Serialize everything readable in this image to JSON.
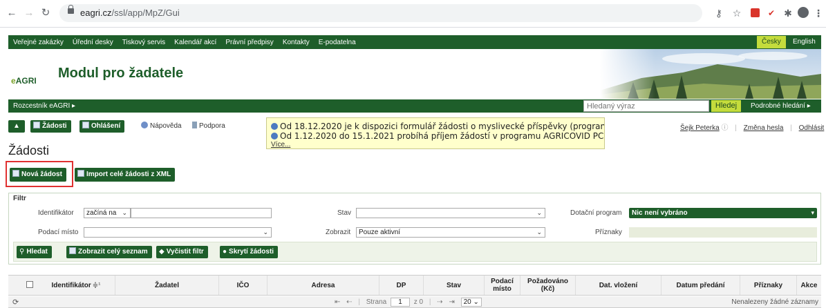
{
  "browser": {
    "url_host": "eagri.cz",
    "url_path": "/ssl/app/MpZ/Gui"
  },
  "topnav": {
    "links": [
      "Veřejné zakázky",
      "Úřední desky",
      "Tiskový servis",
      "Kalendář akcí",
      "Právní předpisy",
      "Kontakty",
      "E-podatelna"
    ],
    "lang_cz": "Česky",
    "lang_en": "English"
  },
  "header": {
    "logo": "AGRI",
    "logo_prefix": "e",
    "title": "Modul pro žadatele"
  },
  "subnav": {
    "rozcestnik": "Rozcestník eAGRI ▸",
    "search_placeholder": "Hledaný výraz",
    "search_button": "Hledej",
    "advanced": "Podrobné hledání ▸"
  },
  "toolbar": {
    "collapse": "▲",
    "zadosti": "Žádosti",
    "ohlaseni": "Ohlášení",
    "napoveda": "Nápověda",
    "podpora": "Podpora"
  },
  "notice": {
    "lines": [
      "Od 18.12.2020 je k dispozici formulář žádosti o myslivecké příspěvky (progran",
      "Od 1.12.2020 do 15.1.2021 probíhá příjem žádostí v programu AGRICOVID PC"
    ],
    "more": "Více..."
  },
  "user": {
    "name": "Šejk Peterka",
    "info": "ⓘ",
    "change_password": "Změna hesla",
    "logout": "Odhlásit"
  },
  "page_title": "Žádosti",
  "actions": {
    "new_request": "Nová žádost",
    "import_xml": "Import celé žádosti z XML"
  },
  "filter": {
    "title": "Filtr",
    "identifikator_label": "Identifikátor",
    "identifikator_mode": "začíná na",
    "identifikator_value": "",
    "stav_label": "Stav",
    "stav_value": "",
    "dotacni_label": "Dotační program",
    "dotacni_value": "Nic není vybráno",
    "podaci_label": "Podací místo",
    "podaci_value": "",
    "zobrazit_label": "Zobrazit",
    "zobrazit_value": "Pouze aktivní",
    "priznaky_label": "Příznaky",
    "buttons": {
      "hledat": "Hledat",
      "seznam": "Zobrazit celý seznam",
      "vycistit": "Vyčistit filtr",
      "skryti": "Skrytí žádosti"
    }
  },
  "table": {
    "columns": [
      "Identifikátor",
      "Žadatel",
      "IČO",
      "Adresa",
      "DP",
      "Stav",
      "Podací místo",
      "Požadováno (Kč)",
      "Dat. vložení",
      "Datum předání",
      "Příznaky",
      "Akce"
    ],
    "sort_indicator": "≑¹"
  },
  "pager": {
    "first": "⇤",
    "prev": "⇠",
    "page_label": "Strana",
    "page": "1",
    "of": "z 0",
    "next": "⇢",
    "last": "⇥",
    "per_page": "20",
    "no_records": "Nenalezeny žádné záznamy"
  },
  "colors": {
    "brand_green": "#1e5e2a",
    "accent_lime": "#c4dc3c",
    "notice_bg": "#ffffcc",
    "highlight_red": "#e03030"
  }
}
